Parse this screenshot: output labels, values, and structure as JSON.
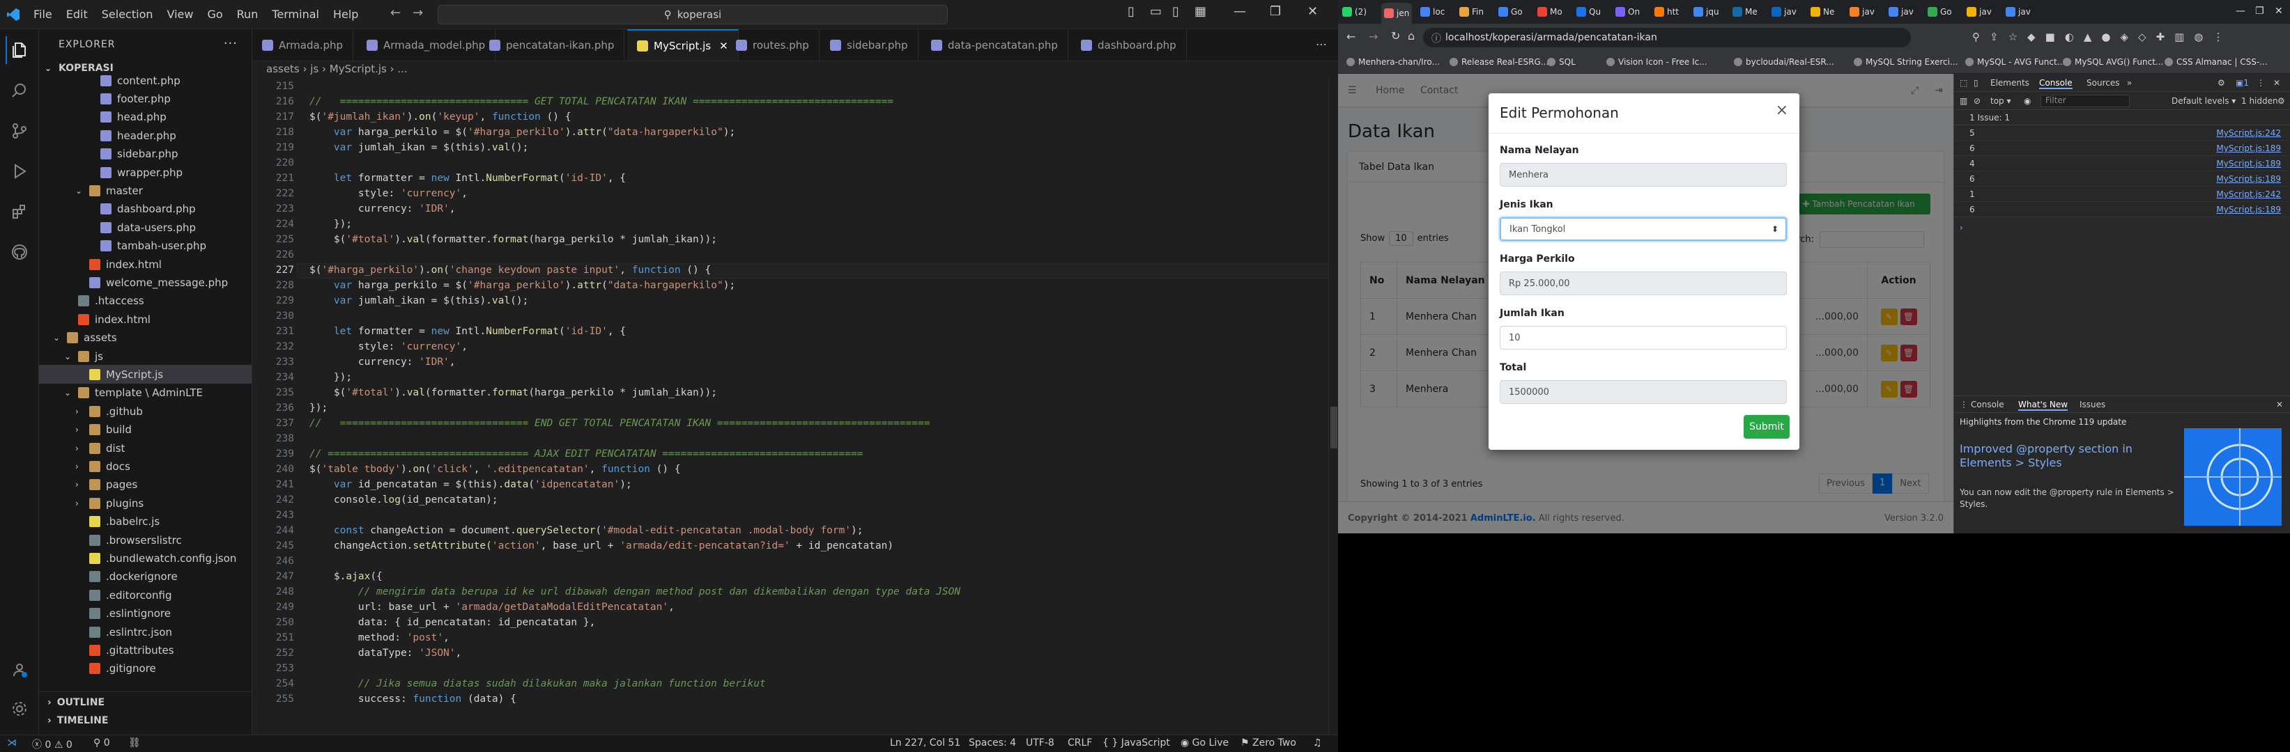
{
  "vscode": {
    "menu": [
      "File",
      "Edit",
      "Selection",
      "View",
      "Go",
      "Run",
      "Terminal",
      "Help"
    ],
    "search": "koperasi",
    "explorer_title": "EXPLORER",
    "project": "KOPERASI",
    "tree": [
      {
        "label": "content.php",
        "type": "php",
        "indent": 3
      },
      {
        "label": "footer.php",
        "type": "php",
        "indent": 3
      },
      {
        "label": "head.php",
        "type": "php",
        "indent": 3
      },
      {
        "label": "header.php",
        "type": "php",
        "indent": 3
      },
      {
        "label": "sidebar.php",
        "type": "php",
        "indent": 3
      },
      {
        "label": "wrapper.php",
        "type": "php",
        "indent": 3
      },
      {
        "label": "master",
        "type": "folder",
        "indent": 2
      },
      {
        "label": "dashboard.php",
        "type": "php",
        "indent": 3
      },
      {
        "label": "data-users.php",
        "type": "php",
        "indent": 3
      },
      {
        "label": "tambah-user.php",
        "type": "php",
        "indent": 3
      },
      {
        "label": "index.html",
        "type": "html",
        "indent": 2
      },
      {
        "label": "welcome_message.php",
        "type": "php",
        "indent": 2
      },
      {
        "label": ".htaccess",
        "type": "gear",
        "indent": 1
      },
      {
        "label": "index.html",
        "type": "html",
        "indent": 1
      },
      {
        "label": "assets",
        "type": "folder",
        "indent": 0
      },
      {
        "label": "js",
        "type": "folder",
        "indent": 1
      },
      {
        "label": "MyScript.js",
        "type": "js",
        "indent": 2,
        "selected": true
      },
      {
        "label": "template \\ AdminLTE",
        "type": "folder",
        "indent": 1
      },
      {
        "label": ".github",
        "type": "folder-c",
        "indent": 2
      },
      {
        "label": "build",
        "type": "folder-c",
        "indent": 2
      },
      {
        "label": "dist",
        "type": "folder-c",
        "indent": 2
      },
      {
        "label": "docs",
        "type": "folder-c",
        "indent": 2
      },
      {
        "label": "pages",
        "type": "folder-c",
        "indent": 2
      },
      {
        "label": "plugins",
        "type": "folder-c",
        "indent": 2
      },
      {
        "label": ".babelrc.js",
        "type": "js",
        "indent": 2
      },
      {
        "label": ".browserslistrc",
        "type": "gear",
        "indent": 2
      },
      {
        "label": ".bundlewatch.config.json",
        "type": "json",
        "indent": 2
      },
      {
        "label": ".dockerignore",
        "type": "gear",
        "indent": 2
      },
      {
        "label": ".editorconfig",
        "type": "gear",
        "indent": 2
      },
      {
        "label": ".eslintignore",
        "type": "gear",
        "indent": 2
      },
      {
        "label": ".eslintrc.json",
        "type": "gear",
        "indent": 2
      },
      {
        "label": ".gitattributes",
        "type": "git",
        "indent": 2
      },
      {
        "label": ".gitignore",
        "type": "git",
        "indent": 2
      }
    ],
    "outline": "OUTLINE",
    "timeline": "TIMELINE",
    "tabs": [
      {
        "label": "Armada.php",
        "icon": "php"
      },
      {
        "label": "Armada_model.php",
        "icon": "php"
      },
      {
        "label": "pencatatan-ikan.php",
        "icon": "php"
      },
      {
        "label": "MyScript.js",
        "icon": "js",
        "active": true
      },
      {
        "label": "routes.php",
        "icon": "php"
      },
      {
        "label": "sidebar.php",
        "icon": "php"
      },
      {
        "label": "data-pencatatan.php",
        "icon": "php"
      },
      {
        "label": "dashboard.php",
        "icon": "php"
      }
    ],
    "breadcrumb": "assets › js › MyScript.js › ...",
    "code": [
      {
        "n": "215",
        "t": ""
      },
      {
        "n": "216",
        "t": "//   =============================== GET TOTAL PENCATATAN IKAN ================================="
      },
      {
        "n": "217",
        "t": "$('#jumlah_ikan').on('keyup', function () {"
      },
      {
        "n": "218",
        "t": "    var harga_perkilo = $('#harga_perkilo').attr(\"data-hargaperkilo\");"
      },
      {
        "n": "219",
        "t": "    var jumlah_ikan = $(this).val();"
      },
      {
        "n": "220",
        "t": ""
      },
      {
        "n": "221",
        "t": "    let formatter = new Intl.NumberFormat('id-ID', {"
      },
      {
        "n": "222",
        "t": "        style: 'currency',"
      },
      {
        "n": "223",
        "t": "        currency: 'IDR',"
      },
      {
        "n": "224",
        "t": "    });"
      },
      {
        "n": "225",
        "t": "    $('#total').val(formatter.format(harga_perkilo * jumlah_ikan));"
      },
      {
        "n": "226",
        "t": ""
      },
      {
        "n": "227",
        "t": "$('#harga_perkilo').on('change keydown paste input', function () {"
      },
      {
        "n": "228",
        "t": "    var harga_perkilo = $('#harga_perkilo').attr(\"data-hargaperkilo\");"
      },
      {
        "n": "229",
        "t": "    var jumlah_ikan = $(this).val();"
      },
      {
        "n": "230",
        "t": ""
      },
      {
        "n": "231",
        "t": "    let formatter = new Intl.NumberFormat('id-ID', {"
      },
      {
        "n": "232",
        "t": "        style: 'currency',"
      },
      {
        "n": "233",
        "t": "        currency: 'IDR',"
      },
      {
        "n": "234",
        "t": "    });"
      },
      {
        "n": "235",
        "t": "    $('#total').val(formatter.format(harga_perkilo * jumlah_ikan));"
      },
      {
        "n": "236",
        "t": "});"
      },
      {
        "n": "237",
        "t": "//   =============================== END GET TOTAL PENCATATAN IKAN ==================================="
      },
      {
        "n": "238",
        "t": ""
      },
      {
        "n": "239",
        "t": "// ================================= AJAX EDIT PENCATATAN ================================="
      },
      {
        "n": "240",
        "t": "$('table tbody').on('click', '.editpencatatan', function () {"
      },
      {
        "n": "241",
        "t": "    var id_pencatatan = $(this).data('idpencatatan');"
      },
      {
        "n": "242",
        "t": "    console.log(id_pencatatan);"
      },
      {
        "n": "243",
        "t": ""
      },
      {
        "n": "244",
        "t": "    const changeAction = document.querySelector('#modal-edit-pencatatan .modal-body form');"
      },
      {
        "n": "245",
        "t": "    changeAction.setAttribute('action', base_url + 'armada/edit-pencatatan?id=' + id_pencatatan)"
      },
      {
        "n": "246",
        "t": ""
      },
      {
        "n": "247",
        "t": "    $.ajax({"
      },
      {
        "n": "248",
        "t": "        // mengirim data berupa id ke url dibawah dengan method post dan dikembalikan dengan type data JSON"
      },
      {
        "n": "249",
        "t": "        url: base_url + 'armada/getDataModalEditPencatatan',"
      },
      {
        "n": "250",
        "t": "        data: { id_pencatatan: id_pencatatan },"
      },
      {
        "n": "251",
        "t": "        method: 'post',"
      },
      {
        "n": "252",
        "t": "        dataType: 'JSON',"
      },
      {
        "n": "253",
        "t": ""
      },
      {
        "n": "254",
        "t": "        // Jika semua diatas sudah dilakukan maka jalankan function berikut"
      },
      {
        "n": "255",
        "t": "        success: function (data) {"
      }
    ],
    "status": {
      "errors": "0",
      "warnings": "0",
      "ports": "0",
      "position": "Ln 227, Col 51",
      "spaces": "Spaces: 4",
      "encoding": "UTF-8",
      "eol": "CRLF",
      "language": "{ } JavaScript",
      "live": "Go Live",
      "theme": "Zero Two"
    }
  },
  "browser": {
    "url": "localhost/koperasi/armada/pencatatan-ikan",
    "bookmarks": [
      "Menhera-chan/Iro...",
      "Release Real-ESRG...",
      "SQL",
      "Vision Icon - Free Ic...",
      "bycloudai/Real-ESR...",
      "MySQL String Exerci...",
      "MySQL - AVG Funct...",
      "MySQL AVG() Funct...",
      "CSS Almanac | CSS-..."
    ],
    "tab_labels": [
      "(2)",
      "jen",
      "loc",
      "Fin",
      "Go",
      "Mo",
      "Qu",
      "On",
      "htt",
      "jqu",
      "Me",
      "jav",
      "Ne",
      "jav",
      "jav",
      "Go",
      "jav",
      "jav"
    ],
    "page": {
      "nav": [
        "Home",
        "Contact"
      ],
      "title": "Data Ikan",
      "card_title": "Tabel Data Ikan",
      "add_button": "Tambah Pencatatan Ikan",
      "show_label": "Show",
      "entries_value": "10",
      "entries_label": "entries",
      "search_label": "Search:",
      "columns": [
        "No",
        "Nama Nelayan",
        "Action"
      ],
      "rows": [
        {
          "no": "1",
          "nama": "Menhera Chan",
          "harga": "...000,00"
        },
        {
          "no": "2",
          "nama": "Menhera Chan",
          "harga": "...000,00"
        },
        {
          "no": "3",
          "nama": "Menhera",
          "harga": "...000,00"
        }
      ],
      "info": "Showing 1 to 3 of 3 entries",
      "prev": "Previous",
      "page_num": "1",
      "next": "Next",
      "footer_left": "Copyright © 2014-2021",
      "footer_link": "AdminLTE.io.",
      "footer_rights": "All rights reserved.",
      "footer_version": "Version 3.2.0"
    },
    "modal": {
      "title": "Edit Permohonan",
      "close": "×",
      "fields": [
        {
          "label": "Nama Nelayan",
          "value": "Menhera",
          "readonly": true
        },
        {
          "label": "Jenis Ikan",
          "value": "Ikan Tongkol",
          "readonly": false,
          "select": true
        },
        {
          "label": "Harga Perkilo",
          "value": "Rp 25.000,00",
          "readonly": true
        },
        {
          "label": "Jumlah Ikan",
          "value": "10",
          "readonly": false
        },
        {
          "label": "Total",
          "value": "1500000",
          "readonly": true
        }
      ],
      "submit": "Submit"
    },
    "devtools": {
      "tabs": [
        "Elements",
        "Console",
        "Sources"
      ],
      "top_context": "top",
      "filter_placeholder": "Filter",
      "levels": "Default levels",
      "hidden": "1 hidden",
      "issues": "1 Issue: 1",
      "logs": [
        {
          "n": "5",
          "src": "MyScript.js:242"
        },
        {
          "n": "6",
          "src": "MyScript.js:189"
        },
        {
          "n": "4",
          "src": "MyScript.js:189"
        },
        {
          "n": "6",
          "src": "MyScript.js:189"
        },
        {
          "n": "1",
          "src": "MyScript.js:242"
        },
        {
          "n": "6",
          "src": "MyScript.js:189"
        }
      ],
      "drawer_tabs": [
        "Console",
        "What's New",
        "Issues"
      ],
      "highlights": "Highlights from the Chrome 119 update",
      "promo_title": "Improved @property section in Elements > Styles",
      "promo_body": "You can now edit the @property rule in Elements > Styles."
    }
  }
}
